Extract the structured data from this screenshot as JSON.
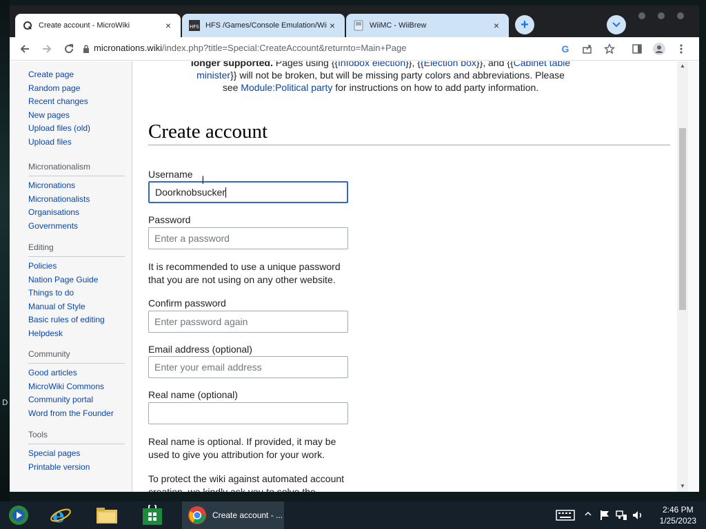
{
  "desktop": {
    "left_letter": "D"
  },
  "tabs": [
    {
      "title": "Create account - MicroWiki",
      "close": "×"
    },
    {
      "title": "HFS /Games/Console Emulation/Wii U/",
      "close": "×"
    },
    {
      "title": "WiiMC - WiiBrew",
      "close": "×"
    }
  ],
  "browser": {
    "new_tab": "+",
    "tab_search": "⌄",
    "url_host": "micronations.wiki",
    "url_path": "/index.php?title=Special:CreateAccount&returnto=Main+Page",
    "google_letter": "G"
  },
  "sidebar": {
    "top_links": [
      "Create page",
      "Random page",
      "Recent changes",
      "New pages",
      "Upload files (old)",
      "Upload files"
    ],
    "sections": [
      {
        "title": "Micronationalism",
        "links": [
          "Micronations",
          "Micronationalists",
          "Organisations",
          "Governments"
        ]
      },
      {
        "title": "Editing",
        "links": [
          "Policies",
          "Nation Page Guide",
          "Things to do",
          "Manual of Style",
          "Basic rules of editing",
          "Helpdesk"
        ]
      },
      {
        "title": "Community",
        "links": [
          "Good articles",
          "MicroWiki Commons",
          "Community portal",
          "Word from the Founder"
        ]
      },
      {
        "title": "Tools",
        "links": [
          "Special pages",
          "Printable version"
        ]
      }
    ]
  },
  "notice": {
    "bold": "longer supported.",
    "t1": " Pages using {{",
    "l1": "Infobox election",
    "t2": "}}, {{",
    "l2": "Election box",
    "t3": "}}, and {{",
    "l3": "Cabinet table minister",
    "t4": "}} will not be broken, but will be missing party colors and abbreviations. Please see ",
    "l4": "Module:Political party",
    "t5": " for instructions on how to add party information."
  },
  "page": {
    "title": "Create account",
    "username_label": "Username",
    "username_value": "Doorknobsucker",
    "password_label": "Password",
    "password_placeholder": "Enter a password",
    "password_help": "It is recommended to use a unique password that you are not using on any other website.",
    "confirm_label": "Confirm password",
    "confirm_placeholder": "Enter password again",
    "email_label": "Email address (optional)",
    "email_placeholder": "Enter your email address",
    "realname_label": "Real name (optional)",
    "realname_value": "",
    "realname_help": "Real name is optional. If provided, it may be used to give you attribution for your work.",
    "captcha_help": "To protect the wiki against automated account creation, we kindly ask you to solve the"
  },
  "taskbar": {
    "task_label": "Create account - ...",
    "time": "2:46 PM",
    "date": "1/25/2023"
  },
  "colors": {
    "link": "#0645ad",
    "tab_inactive": "#cfe3f6",
    "focus": "#3366cc"
  }
}
